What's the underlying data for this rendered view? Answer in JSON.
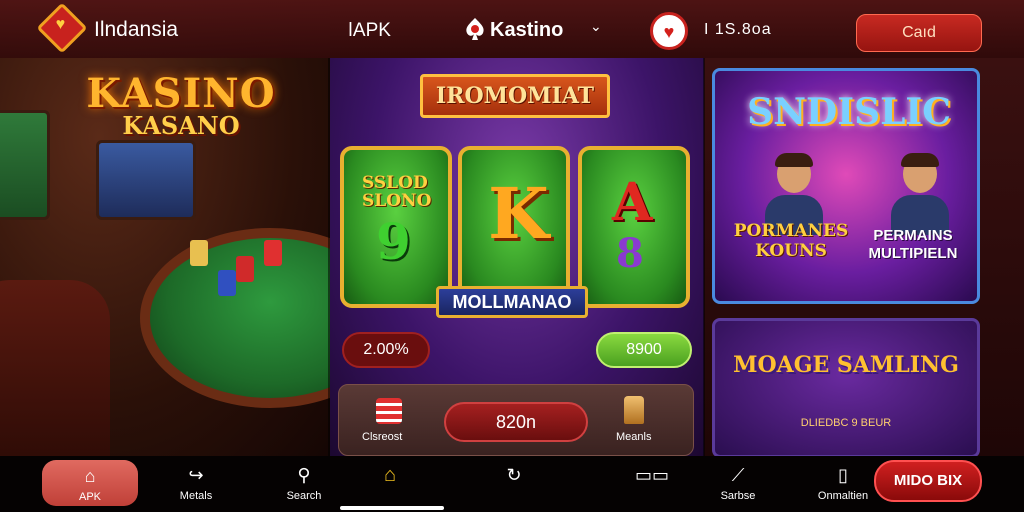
{
  "header": {
    "brand_name": "Ilndansia",
    "apk_label": "ǀAPK",
    "kastino_label": "Kastino",
    "dropdown_glyph": "⌄",
    "balance": "I 1S.8oa",
    "cta_label": "Caıd",
    "brand_icon": "card-suit-icon",
    "heart_icon": "heart-icon"
  },
  "left": {
    "logo_line1": "KASINO",
    "logo_line2": "KASANO"
  },
  "center": {
    "banner": "IROMOMIAT",
    "reel1_text": "SSLOD SLONO",
    "reel1_symbol": "9",
    "reel2_symbol": "K",
    "reel3_symbol": "A",
    "reel3_symbol2": "8",
    "reel_label": "MOLLMANAO",
    "pct_pill": "2.00%",
    "win_pill": "8900",
    "bottom_left_label": "Clsreost",
    "bottom_center": "820n",
    "bottom_right_label": "Meanls"
  },
  "right": {
    "top_title": "SNDISLIC",
    "top_left_text": "PORMANES KOUNS",
    "top_right_text": "PERMAINS MULTIPIELN",
    "bottom_title": "MOAGE SAMLING",
    "bottom_sub": "DLIEDBC 9 BEUR"
  },
  "nav": {
    "items": [
      {
        "label": "APK",
        "icon": "home-icon"
      },
      {
        "label": "Metals",
        "icon": "share-icon"
      },
      {
        "label": "Search",
        "icon": "search-icon"
      },
      {
        "label": "",
        "icon": "home-icon"
      },
      {
        "label": "",
        "icon": "refresh-icon"
      },
      {
        "label": "",
        "icon": "tabs-icon"
      },
      {
        "label": "Sarbse",
        "icon": "bandage-icon"
      },
      {
        "label": "Onmaltien",
        "icon": "phone-icon"
      }
    ],
    "cta_label": "MIDO BIX"
  },
  "colors": {
    "accent_red": "#c8221e",
    "accent_gold": "#f0a020",
    "felt_green": "#2e9a3e",
    "promo_purple": "#6a1ea0"
  }
}
